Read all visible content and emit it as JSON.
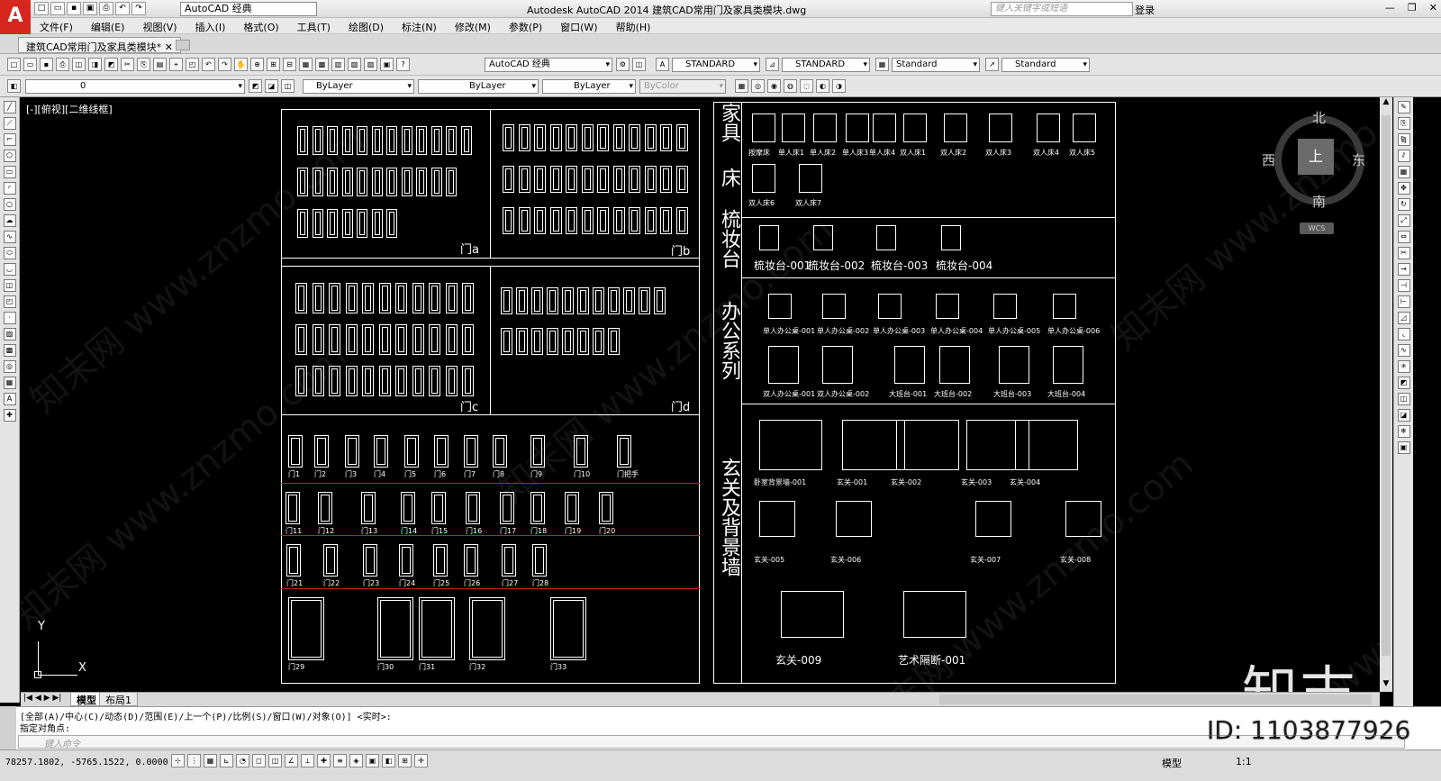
{
  "app": {
    "title": "Autodesk AutoCAD 2014    建筑CAD常用门及家具类模块.dwg",
    "logo": "A",
    "workspace": "AutoCAD 经典",
    "search_placeholder": "键入关键字或短语",
    "login": "登录"
  },
  "menu": [
    "文件(F)",
    "编辑(E)",
    "视图(V)",
    "插入(I)",
    "格式(O)",
    "工具(T)",
    "绘图(D)",
    "标注(N)",
    "修改(M)",
    "参数(P)",
    "窗口(W)",
    "帮助(H)"
  ],
  "doc_tab": "建筑CAD常用门及家具类模块*",
  "toolbar": {
    "workspace2": "AutoCAD 经典",
    "text_style": "STANDARD",
    "dim_style": "STANDARD",
    "table_style": "Standard",
    "mleader_style": "Standard",
    "layer": "0",
    "color": "ByLayer",
    "linetype": "ByLayer",
    "lineweight": "ByLayer",
    "plotstyle": "ByColor"
  },
  "viewport": {
    "label": "[-][俯视][二维线框]",
    "compass": {
      "n": "北",
      "s": "南",
      "w": "西",
      "e": "东",
      "top": "上",
      "wcs": "WCS"
    },
    "ucs": {
      "x": "X",
      "y": "Y"
    }
  },
  "drawing": {
    "door_panels": [
      "门a",
      "门b",
      "门c",
      "门d"
    ],
    "doors_row1": [
      "门1",
      "门2",
      "门3",
      "门4",
      "门5",
      "门6",
      "门7",
      "门8",
      "门9",
      "门10",
      "门把手"
    ],
    "doors_row2": [
      "门11",
      "门12",
      "门13",
      "门14",
      "门15",
      "门16",
      "门17",
      "门18",
      "门19",
      "门20"
    ],
    "doors_row3": [
      "门21",
      "门22",
      "门23",
      "门24",
      "门25",
      "门26",
      "门27",
      "门28"
    ],
    "doors_row4": [
      "门29",
      "门30",
      "门31",
      "门32",
      "门33"
    ],
    "vertical_titles": {
      "furniture": "家具",
      "bed": "床",
      "dresser": "梳妆台",
      "office": "办公系列",
      "entrance": "玄关及背景墙"
    },
    "beds": [
      "按摩床",
      "单人床1",
      "单人床2",
      "单人床3",
      "单人床4",
      "双人床1",
      "双人床2",
      "双人床3",
      "双人床4",
      "双人床5",
      "双人床6",
      "双人床7"
    ],
    "dressers": [
      "梳妆台-001",
      "梳妆台-002",
      "梳妆台-003",
      "梳妆台-004"
    ],
    "office_row1": [
      "单人办公桌-001",
      "单人办公桌-002",
      "单人办公桌-003",
      "单人办公桌-004",
      "单人办公桌-005",
      "单人办公桌-006"
    ],
    "office_row2": [
      "双人办公桌-001",
      "双人办公桌-002",
      "大班台-001",
      "大班台-002",
      "大班台-003",
      "大班台-004"
    ],
    "entrance_row1": [
      "卧室背景墙-001",
      "玄关-001",
      "玄关-002",
      "玄关-003",
      "玄关-004"
    ],
    "entrance_row2": [
      "玄关-005",
      "玄关-006",
      "玄关-007",
      "玄关-008"
    ],
    "entrance_row3": [
      "玄关-009",
      "艺术隔断-001"
    ]
  },
  "watermarks": [
    "知末网 www.znzmo.com"
  ],
  "brand": "知末",
  "id_text": "ID: 1103877926",
  "layout_tabs": [
    "模型",
    "布局1"
  ],
  "command": {
    "history1": "[全部(A)/中心(C)/动态(D)/范围(E)/上一个(P)/比例(S)/窗口(W)/对象(O)] <实时>:",
    "history2": "指定对角点:",
    "input_placeholder": "键入命令"
  },
  "status": {
    "coords": "78257.1802, -5765.1522, 0.0000",
    "model": "模型",
    "scale": "1:1"
  }
}
